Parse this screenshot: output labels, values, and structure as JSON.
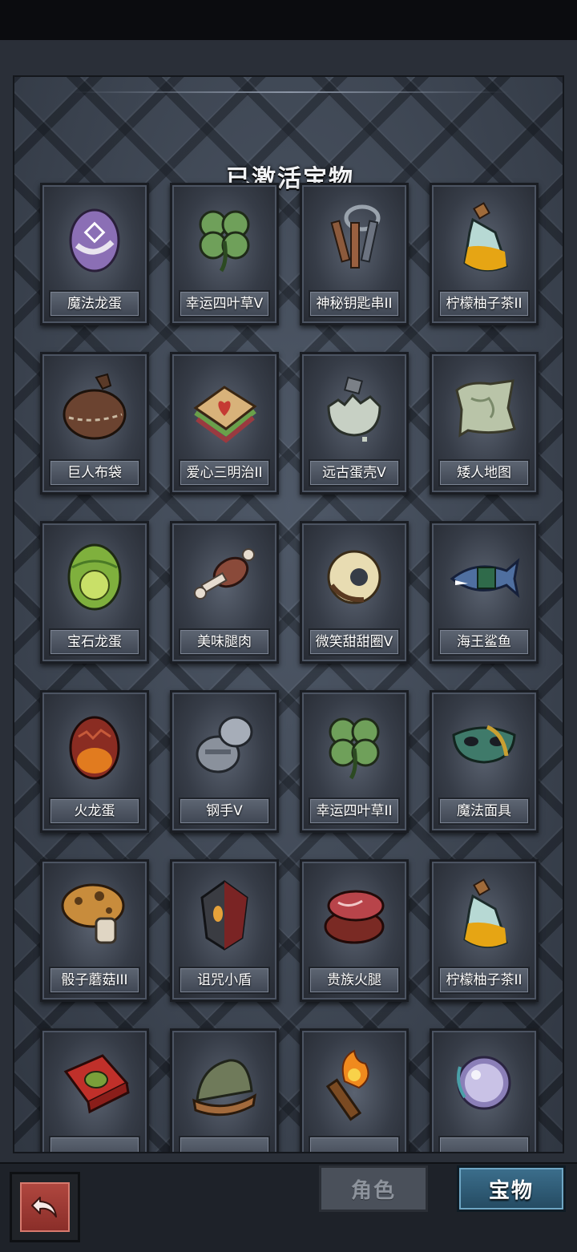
{
  "panel": {
    "title": "已激活宝物"
  },
  "items": [
    {
      "label": "魔法龙蛋",
      "icon": "magic-dragon-egg-icon"
    },
    {
      "label": "幸运四叶草V",
      "icon": "four-leaf-clover-icon"
    },
    {
      "label": "神秘钥匙串II",
      "icon": "key-ring-icon"
    },
    {
      "label": "柠檬柚子茶II",
      "icon": "potion-bottle-icon"
    },
    {
      "label": "巨人布袋",
      "icon": "sack-icon"
    },
    {
      "label": "爱心三明治II",
      "icon": "sandwich-icon"
    },
    {
      "label": "远古蛋壳V",
      "icon": "egg-shell-icon"
    },
    {
      "label": "矮人地图",
      "icon": "map-scroll-icon"
    },
    {
      "label": "宝石龙蛋",
      "icon": "gem-dragon-egg-icon"
    },
    {
      "label": "美味腿肉",
      "icon": "meat-leg-icon"
    },
    {
      "label": "微笑甜甜圈V",
      "icon": "donut-icon"
    },
    {
      "label": "海王鲨鱼",
      "icon": "shark-icon"
    },
    {
      "label": "火龙蛋",
      "icon": "fire-dragon-egg-icon"
    },
    {
      "label": "钢手V",
      "icon": "steel-gauntlet-icon"
    },
    {
      "label": "幸运四叶草II",
      "icon": "four-leaf-clover-icon"
    },
    {
      "label": "魔法面具",
      "icon": "magic-mask-icon"
    },
    {
      "label": "骰子蘑菇III",
      "icon": "mushroom-icon"
    },
    {
      "label": "诅咒小盾",
      "icon": "cursed-shield-icon"
    },
    {
      "label": "贵族火腿",
      "icon": "ham-steak-icon"
    },
    {
      "label": "柠檬柚子茶II",
      "icon": "potion-bottle-icon"
    },
    {
      "label": "",
      "icon": "spell-book-icon"
    },
    {
      "label": "",
      "icon": "wool-hat-icon"
    },
    {
      "label": "",
      "icon": "torch-icon"
    },
    {
      "label": "",
      "icon": "crystal-ball-icon"
    }
  ],
  "tabs": {
    "role": "角色",
    "treasure": "宝物"
  },
  "colors": {
    "panel": "#4b5564",
    "active_tab": "#2f5d78",
    "back_button": "#9c3a33"
  }
}
